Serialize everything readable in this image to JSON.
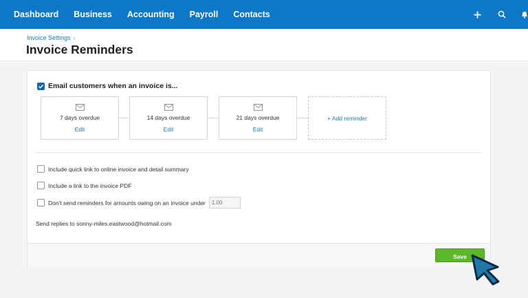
{
  "nav": {
    "items": [
      "Dashboard",
      "Business",
      "Accounting",
      "Payroll",
      "Contacts"
    ],
    "icons": [
      "plus-icon",
      "search-icon",
      "bell-icon"
    ]
  },
  "header": {
    "breadcrumb": "Invoice Settings",
    "breadcrumb_sep": "›",
    "title": "Invoice Reminders"
  },
  "main": {
    "email_toggle": {
      "label": "Email customers when an invoice is...",
      "checked": true
    },
    "reminders": [
      {
        "label": "7 days overdue",
        "edit": "Edit"
      },
      {
        "label": "14 days overdue",
        "edit": "Edit"
      },
      {
        "label": "21 days overdue",
        "edit": "Edit"
      }
    ],
    "add_reminder": "+ Add reminder",
    "options": [
      {
        "label": "Include quick link to online invoice and detail summary",
        "checked": false
      },
      {
        "label": "Include a link to the invoice PDF",
        "checked": false
      },
      {
        "label": "Don't send reminders for amounts owing on an invoice under",
        "checked": false
      }
    ],
    "amount_placeholder": "1.00",
    "reply_text": "Send replies to sonny-miles.eastwood@hotmail.com"
  },
  "footer": {
    "save_label": "Save"
  },
  "colors": {
    "nav_bg": "#0d77c8",
    "link": "#1a7bb9",
    "save_bg": "#5cb82a",
    "cursor": "#1f78a7"
  }
}
